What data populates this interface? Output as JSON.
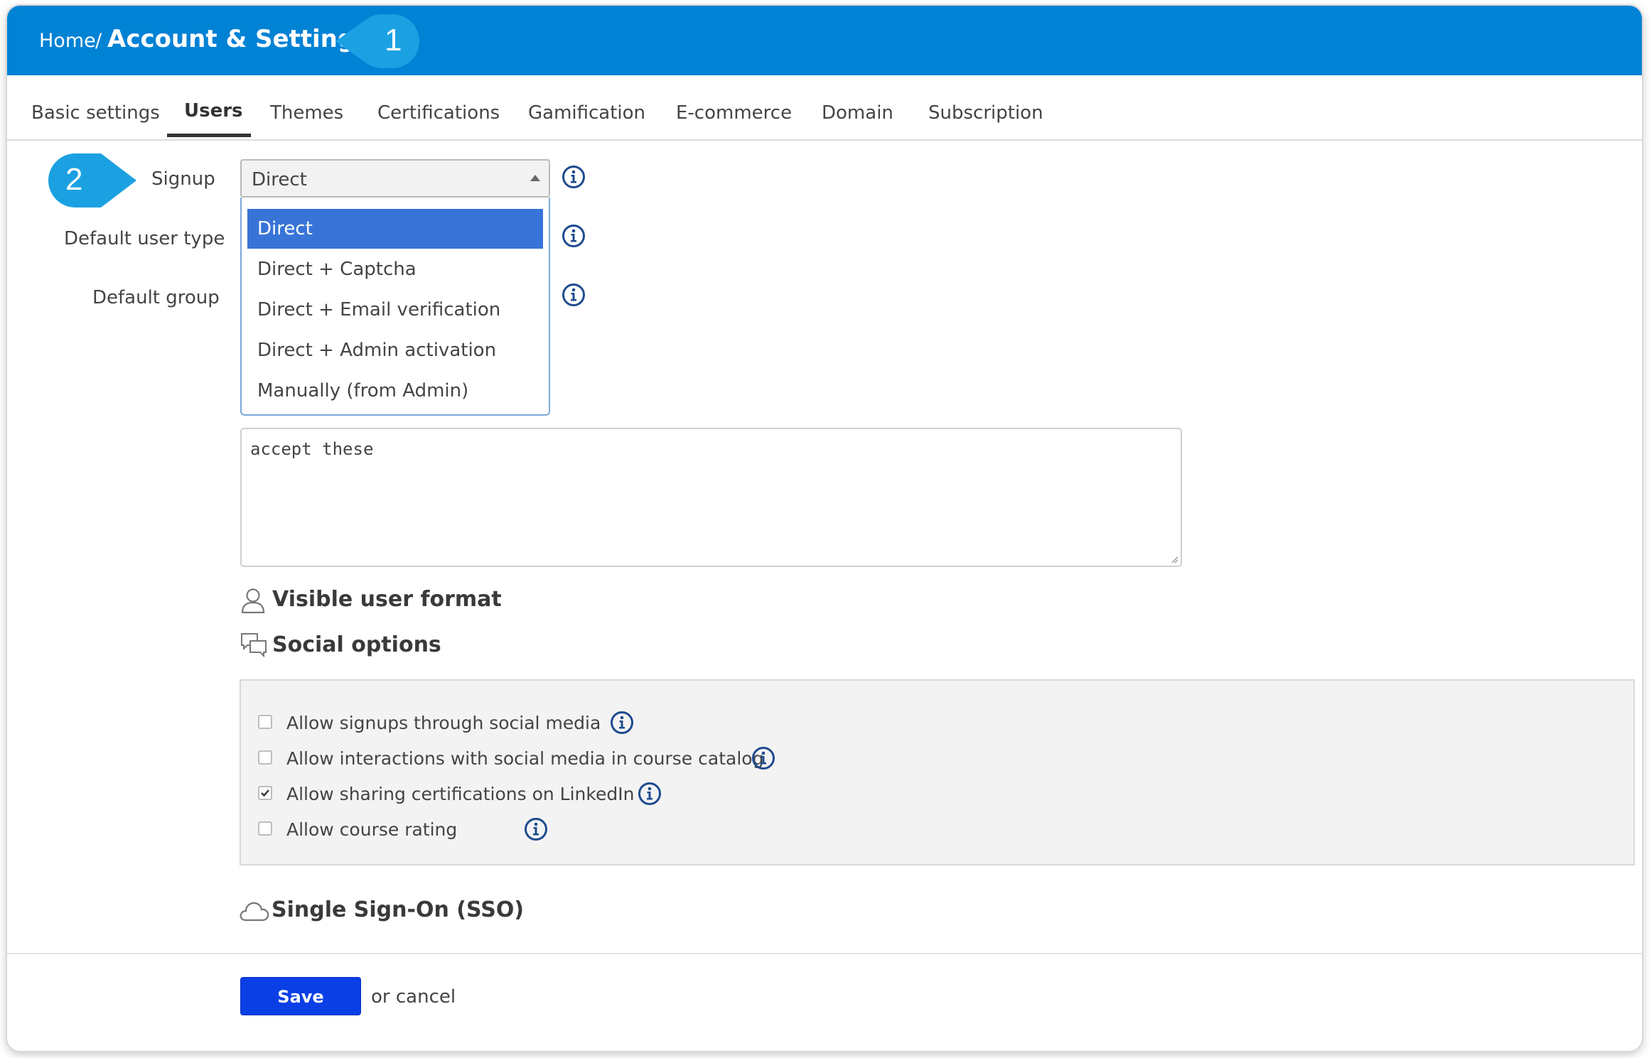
{
  "header": {
    "breadcrumb_home": "Home",
    "breadcrumb_separator": "/",
    "title": "Account & Settings",
    "callout_step": "1",
    "bar_color": "#0082d5"
  },
  "tabs": [
    {
      "label": "Basic settings",
      "active": false
    },
    {
      "label": "Users",
      "active": true
    },
    {
      "label": "Themes",
      "active": false
    },
    {
      "label": "Certifications",
      "active": false
    },
    {
      "label": "Gamification",
      "active": false
    },
    {
      "label": "E-commerce",
      "active": false
    },
    {
      "label": "Domain",
      "active": false
    },
    {
      "label": "Subscription",
      "active": false
    }
  ],
  "form": {
    "callout_step": "2",
    "signup_label": "Signup",
    "default_user_type_label": "Default user type",
    "default_group_label": "Default group",
    "signup_select": {
      "value": "Direct",
      "options": [
        "Direct",
        "Direct + Captcha",
        "Direct + Email verification",
        "Direct + Admin activation",
        "Manually (from Admin)"
      ],
      "highlighted_index": 0
    },
    "terms_text": "accept these"
  },
  "sections": {
    "visible_user_format": "Visible user format",
    "social_options": "Social options",
    "sso": "Single Sign-On (SSO)"
  },
  "social_options": [
    {
      "label": "Allow signups through social media",
      "checked": false
    },
    {
      "label": "Allow interactions with social media in course catalog",
      "checked": false
    },
    {
      "label": "Allow sharing certifications on LinkedIn",
      "checked": true
    },
    {
      "label": "Allow course rating",
      "checked": false
    }
  ],
  "footer": {
    "save_label": "Save",
    "cancel_text": "or cancel"
  },
  "colors": {
    "accent": "#0082d5",
    "callout": "#1ba1e2",
    "info_icon": "#1e4b8f",
    "save_button": "#0a3fe6",
    "highlight": "#3874d8"
  }
}
